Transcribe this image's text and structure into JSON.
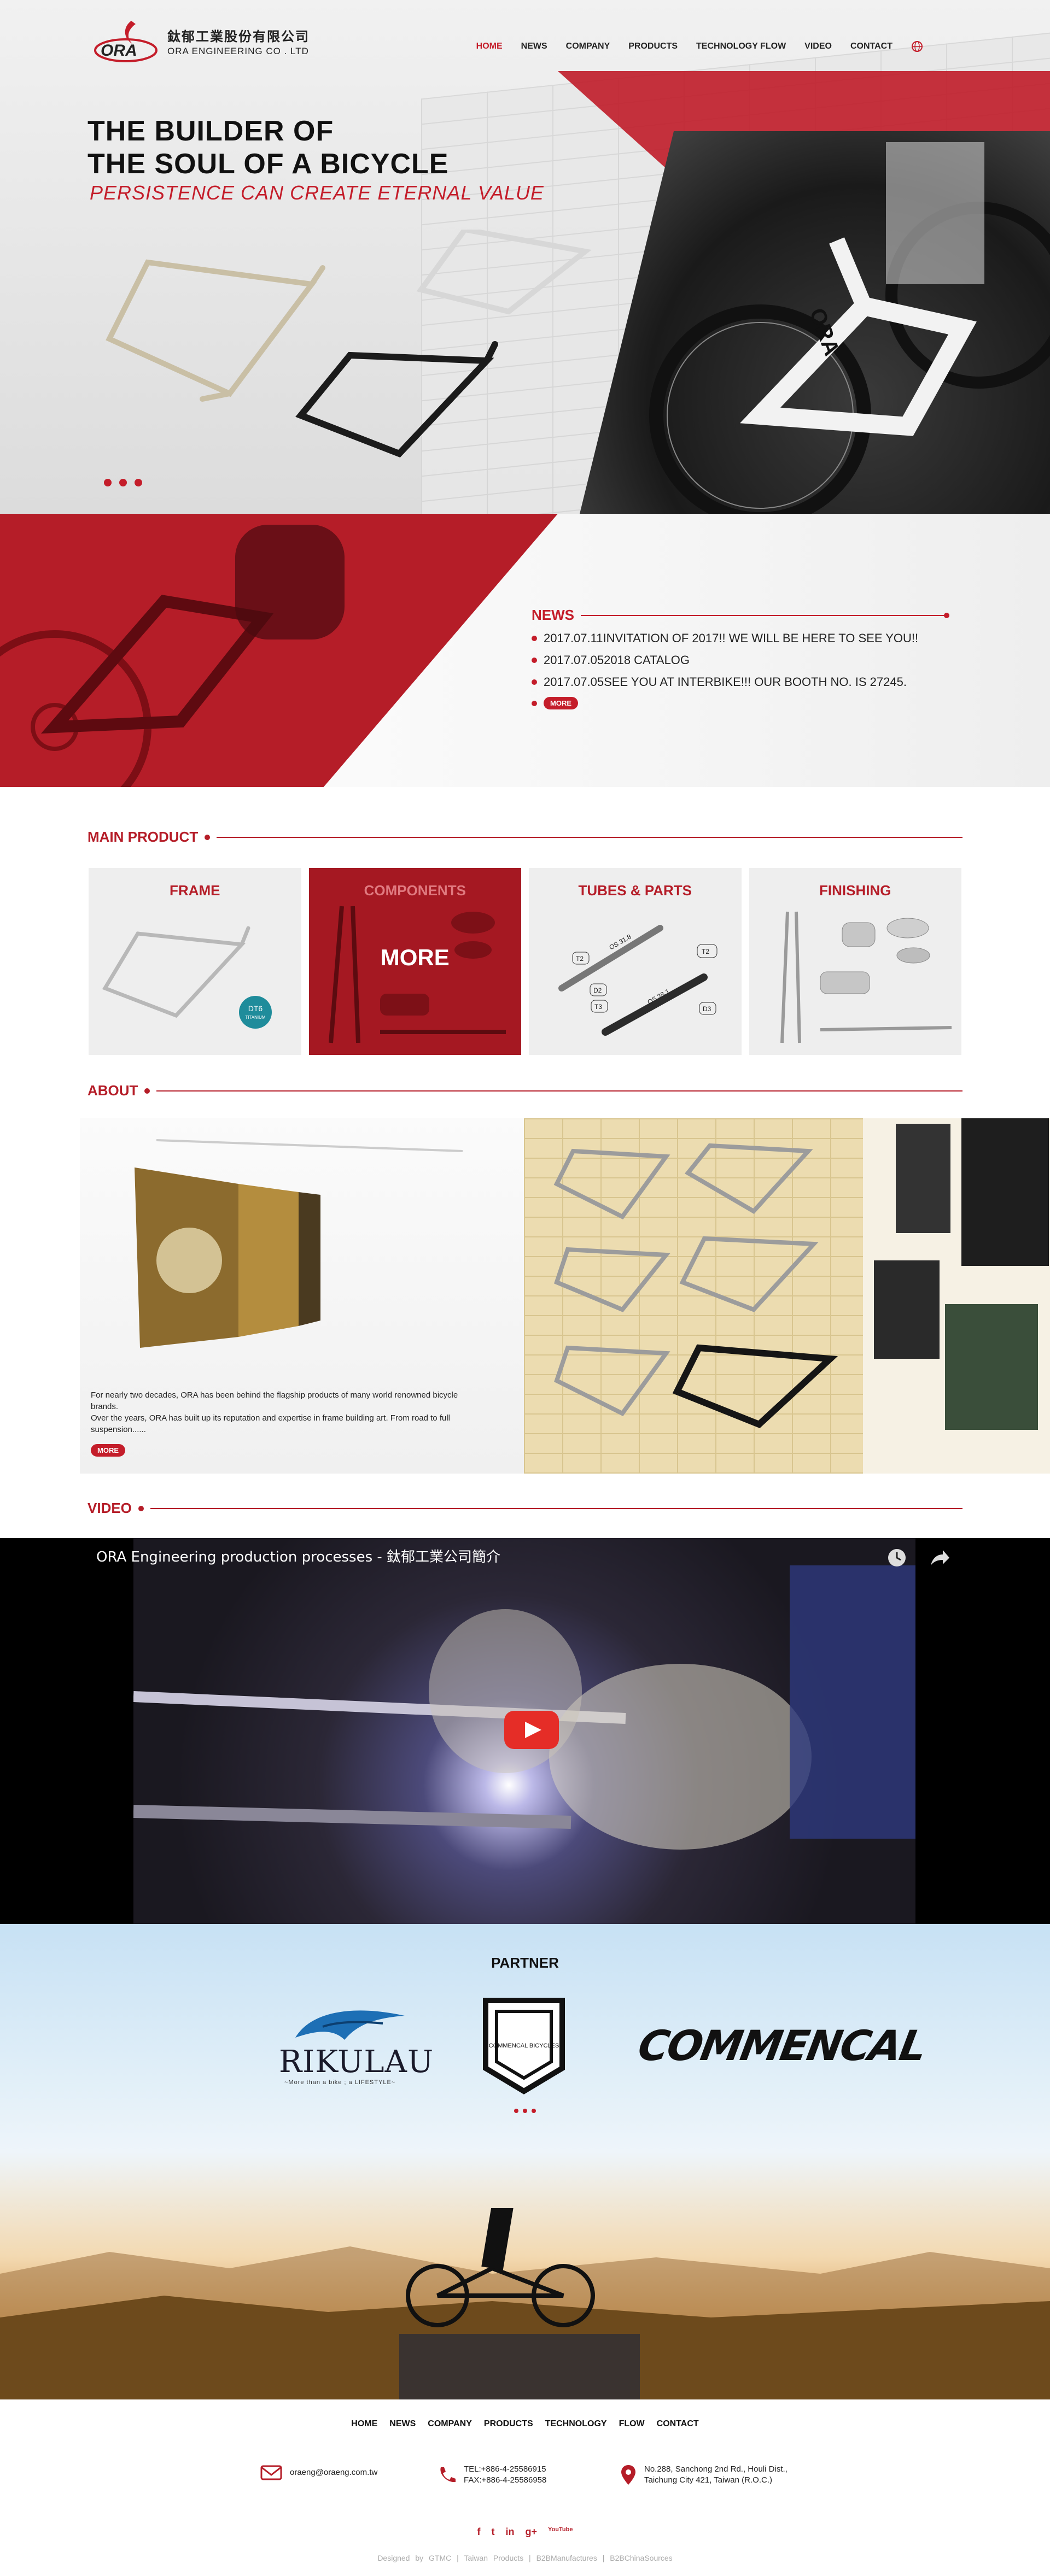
{
  "brand": {
    "name_cn": "鈦郁工業股份有限公司",
    "name_en": "ORA ENGINEERING CO . LTD",
    "mark": "ORA"
  },
  "nav": {
    "items": [
      "HOME",
      "NEWS",
      "COMPANY",
      "PRODUCTS",
      "TECHNOLOGY FLOW",
      "VIDEO",
      "CONTACT"
    ],
    "active": "HOME",
    "globe_icon": "globe-icon"
  },
  "hero": {
    "title_line1": "THE BUILDER OF",
    "title_line2": "THE SOUL OF A BICYCLE",
    "subtitle": "PERSISTENCE CAN CREATE ETERNAL VALUE",
    "bike_brand": "ORA",
    "frame_brand": "ORA",
    "slides": 3
  },
  "news": {
    "title": "NEWS",
    "items": [
      "2017.07.11INVITATION OF 2017!! WE WILL BE HERE TO SEE YOU!!",
      "2017.07.052018 CATALOG",
      "2017.07.05SEE YOU AT INTERBIKE!!! OUR BOOTH NO. IS 27245."
    ],
    "more": "MORE"
  },
  "main_product": {
    "title": "MAIN PRODUCT",
    "items": [
      {
        "label": "FRAME",
        "badge": "DT6",
        "badge_sub": "TITANIUM"
      },
      {
        "label": "COMPONENTS",
        "overlay": "MORE"
      },
      {
        "label": "TUBES & PARTS",
        "tags": [
          "T2",
          "T2",
          "T3",
          "D3",
          "D2"
        ],
        "tube_labels": [
          "OS 31.8",
          "OS 38.1"
        ]
      },
      {
        "label": "FINISHING"
      }
    ]
  },
  "about": {
    "title": "ABOUT",
    "text_line1": "For nearly two decades, ORA has been behind the flagship products of many world renowned bicycle brands.",
    "text_line2": "Over the years, ORA has built up its reputation and expertise in frame building art. From road to full suspension......",
    "more": "MORE"
  },
  "video": {
    "title": "VIDEO",
    "caption": "ORA Engineering production processes - 鈦郁工業公司簡介",
    "play_icon": "youtube-play-icon",
    "clock_icon": "watch-later-icon",
    "share_icon": "share-icon"
  },
  "partner": {
    "title": "PARTNER",
    "logos": [
      {
        "name": "RIKULAU",
        "tagline": "~More than a bike ; a LIFESTYLE~"
      },
      {
        "name": "COMMENCAL BICYCLES"
      },
      {
        "name": "COMMENCAL"
      }
    ]
  },
  "footer": {
    "nav": [
      "HOME",
      "NEWS",
      "COMPANY",
      "PRODUCTS",
      "TECHNOLOGY",
      "FLOW",
      "CONTACT"
    ],
    "email": "oraeng@oraeng.com.tw",
    "tel": "TEL:+886-4-25586915",
    "fax": "FAX:+886-4-25586958",
    "address_line1": "No.288, Sanchong 2nd Rd., Houli Dist.,",
    "address_line2": "Taichung City 421, Taiwan (R.O.C.)",
    "social": [
      "f",
      "t",
      "in",
      "g+",
      "YouTube"
    ],
    "credits": [
      "Designed by GTMC",
      "|",
      "Taiwan Products",
      "|",
      "B2BManufactures",
      "|",
      "B2BChinaSources"
    ]
  },
  "colors": {
    "accent": "#c41d2a",
    "dark_red": "#b51d28",
    "text": "#222222"
  }
}
